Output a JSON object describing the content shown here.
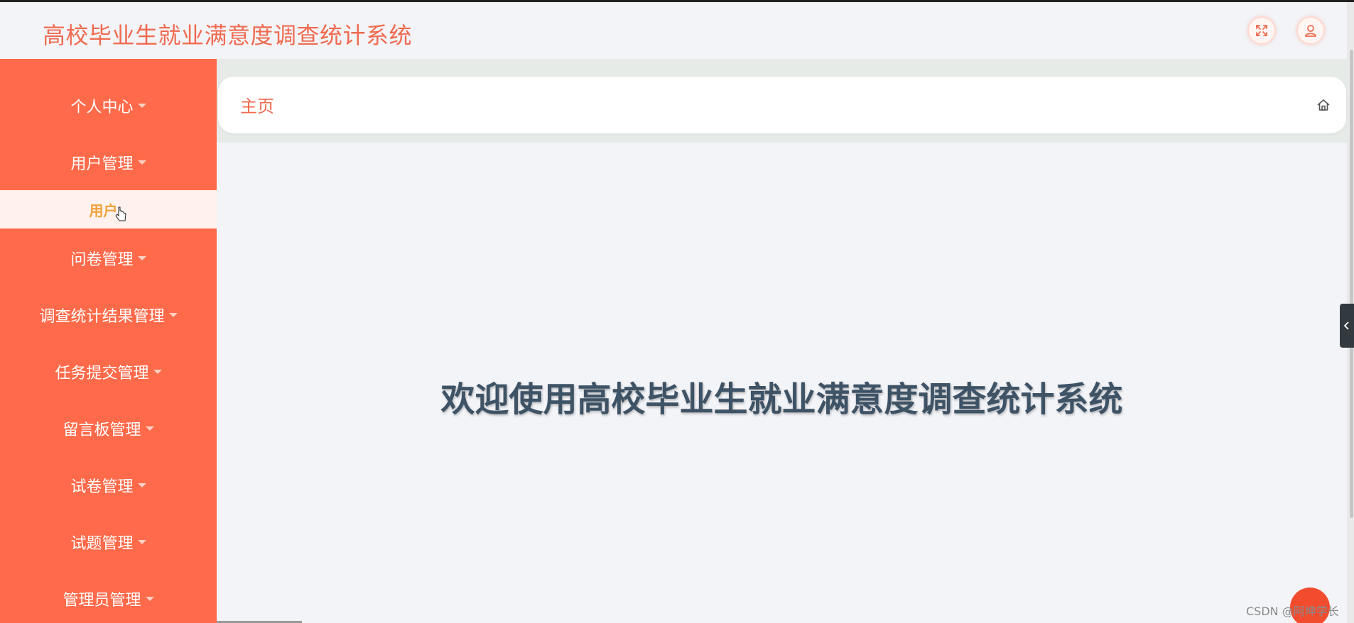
{
  "header": {
    "title": "高校毕业生就业满意度调查统计系统",
    "fullscreen_icon": "fullscreen-icon",
    "user_icon": "user-icon"
  },
  "sidebar": {
    "items": [
      {
        "label": "个人中心"
      },
      {
        "label": "用户管理"
      },
      {
        "label": "问卷管理"
      },
      {
        "label": "调查统计结果管理"
      },
      {
        "label": "任务提交管理"
      },
      {
        "label": "留言板管理"
      },
      {
        "label": "试卷管理"
      },
      {
        "label": "试题管理"
      },
      {
        "label": "管理员管理"
      }
    ],
    "submenu": {
      "label": "用户"
    }
  },
  "breadcrumb": {
    "label": "主页",
    "icon": "home-icon"
  },
  "main": {
    "welcome": "欢迎使用高校毕业生就业满意度调查统计系统"
  },
  "watermark": "CSDN @阿坤学长",
  "colors": {
    "accent": "#ff6a4a",
    "title": "#f06a50",
    "submenu_text": "#f0a23a",
    "welcome_text": "#3e5366",
    "background": "#f3f4f8"
  }
}
